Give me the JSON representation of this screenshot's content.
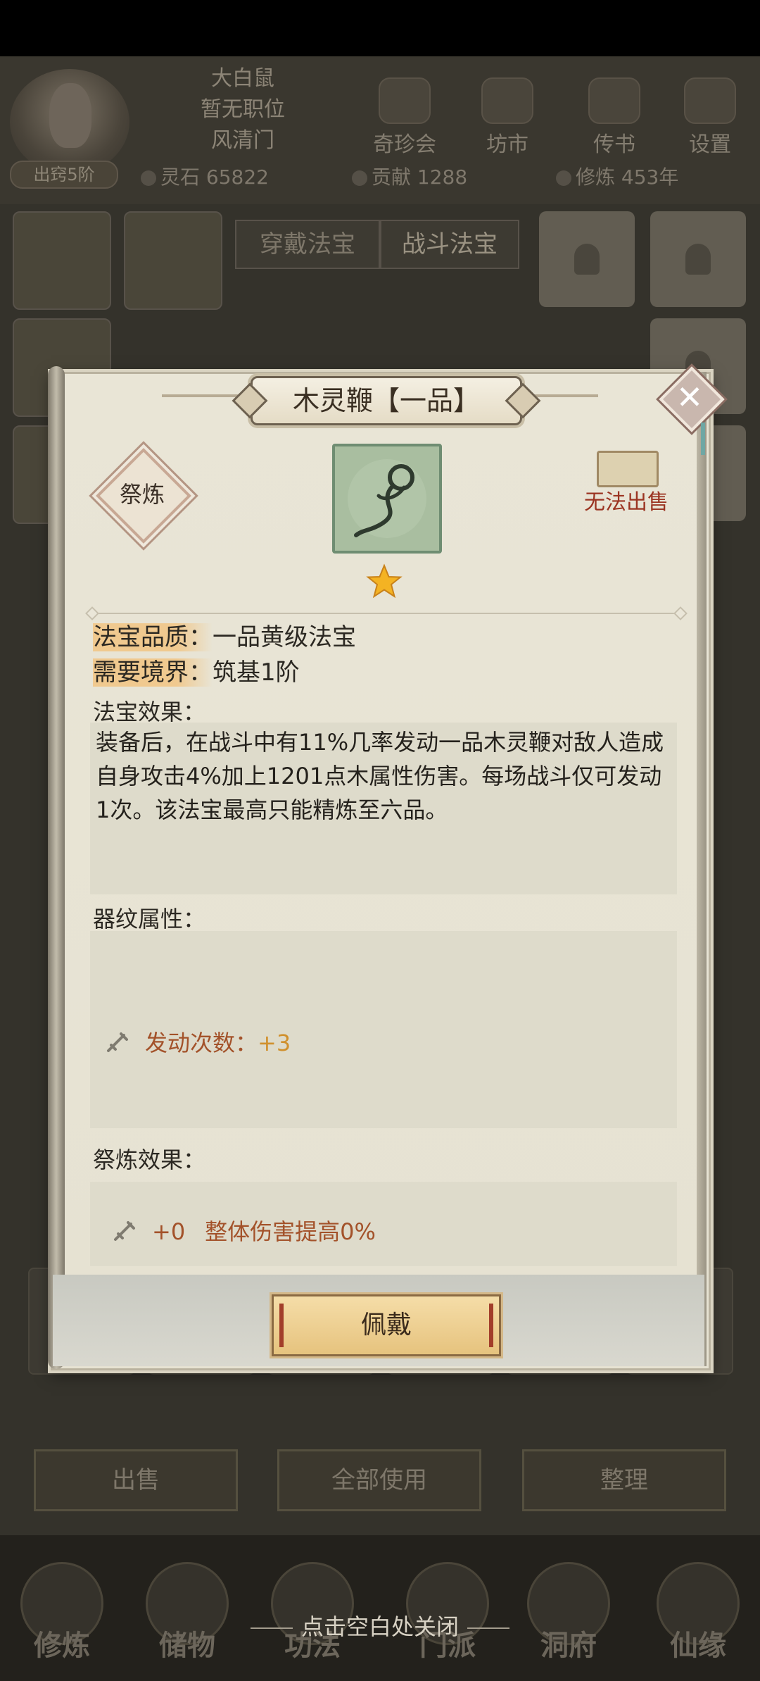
{
  "player": {
    "name": "大白鼠",
    "position": "暂无职位",
    "sect": "风清门",
    "realm_badge": "出窍5阶"
  },
  "top_menu": [
    {
      "label": "奇珍会",
      "icon": "treasure-icon"
    },
    {
      "label": "坊市",
      "icon": "market-icon"
    },
    {
      "label": "传书",
      "icon": "mail-icon"
    },
    {
      "label": "设置",
      "icon": "gear-icon"
    }
  ],
  "resources": {
    "spirit_stone": "灵石 65822",
    "contribution": "贡献 1288",
    "cultivation": "修炼 453年"
  },
  "equip_tabs": {
    "worn": "穿戴法宝",
    "battle": "战斗法宝"
  },
  "bag_actions": {
    "sell": "出售",
    "use_all": "全部使用",
    "sort": "整理"
  },
  "bottom_nav": [
    {
      "label": "修炼"
    },
    {
      "label": "储物"
    },
    {
      "label": "功法"
    },
    {
      "label": "门派"
    },
    {
      "label": "洞府"
    },
    {
      "label": "仙缘"
    }
  ],
  "close_hint": "点击空白处关闭",
  "modal": {
    "title": "木灵鞭【一品】",
    "refine_badge": "祭炼",
    "sell_status": "无法出售",
    "quality_label": "法宝品质：",
    "quality_value": "一品黄级法宝",
    "realm_label": "需要境界：",
    "realm_value": "筑基1阶",
    "effect_title": "法宝效果：",
    "effect_text": "装备后，在战斗中有11%几率发动一品木灵鞭对敌人造成自身攻击4%加上1201点木属性伤害。每场战斗仅可发动1次。该法宝最高只能精炼至六品。",
    "pattern_title": "器纹属性：",
    "pattern_attr_label": "发动次数：",
    "pattern_attr_value": "+3",
    "refine_title": "祭炼效果：",
    "refine_attr_value": "+0",
    "refine_attr_label": "整体伤害提高0%",
    "wear_button": "佩戴",
    "stars": 1
  },
  "colors": {
    "quality_highlight": "#f0c98f",
    "attr_label": "#a3522a",
    "attr_value": "#d0902c",
    "no_sell": "#9b3422"
  }
}
